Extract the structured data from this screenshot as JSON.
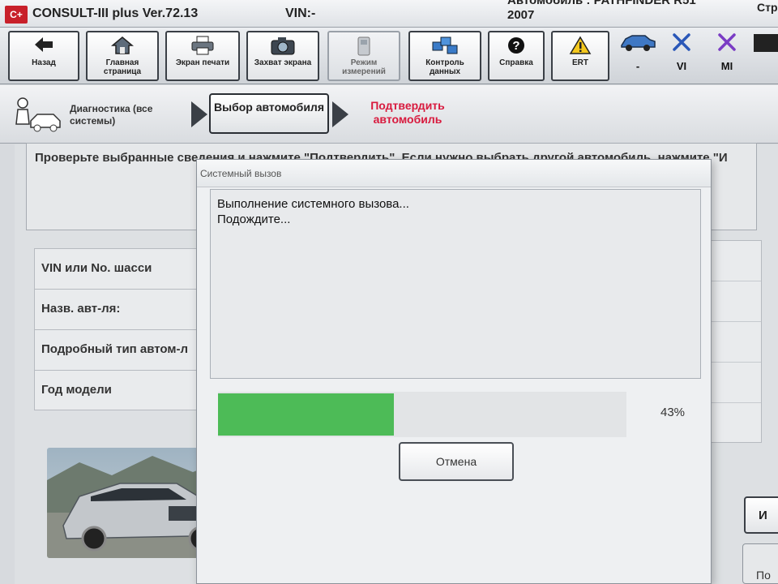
{
  "titlebar": {
    "logo": "C+",
    "app_title": "CONSULT-III plus  Ver.72.13",
    "vin_label": "VIN:-",
    "vehicle_info_line1": "Автомобиль : PATHFINDER R51",
    "vehicle_info_line2": "2007",
    "page_label": "Стр"
  },
  "toolbar": {
    "buttons": [
      {
        "label": "Назад",
        "icon": "arrow-left-icon"
      },
      {
        "label": "Главная страница",
        "icon": "home-icon"
      },
      {
        "label": "Экран печати",
        "icon": "printer-icon"
      },
      {
        "label": "Захват экрана",
        "icon": "camera-icon"
      },
      {
        "label": "Режим измерений",
        "icon": "measurement-icon"
      },
      {
        "label": "Контроль данных",
        "icon": "data-monitor-icon"
      },
      {
        "label": "Справка",
        "icon": "help-icon"
      },
      {
        "label": "ERT",
        "icon": "warning-icon"
      }
    ],
    "status": [
      {
        "label": "-",
        "icon": "car-icon"
      },
      {
        "label": "VI",
        "icon": "cross-icon"
      },
      {
        "label": "MI",
        "icon": "cross-icon"
      }
    ]
  },
  "breadcrumb": {
    "step1": "Диагностика (все системы)",
    "step2": "Выбор автомобиля",
    "step3": "Подтвердить автомобиль"
  },
  "main": {
    "instruction": "Проверьте выбранные сведения и нажмите \"Подтвердить\". Если нужно выбрать другой автомобиль, нажмите \"И",
    "rows": [
      "VIN или No. шасси",
      "Назв. авт-ля:",
      "Подробный тип автом-л",
      "Год модели"
    ],
    "side_button": "И",
    "side_button2": "По"
  },
  "dialog": {
    "title": "Системный вызов",
    "message_line1": "Выполнение системного вызова...",
    "message_line2": "Подождите...",
    "progress_percent": 43,
    "progress_text": "43%",
    "cancel_label": "Отмена"
  },
  "colors": {
    "progress": "#4dbb57",
    "accent_red": "#d81a3e",
    "logo_red": "#c8202a"
  }
}
